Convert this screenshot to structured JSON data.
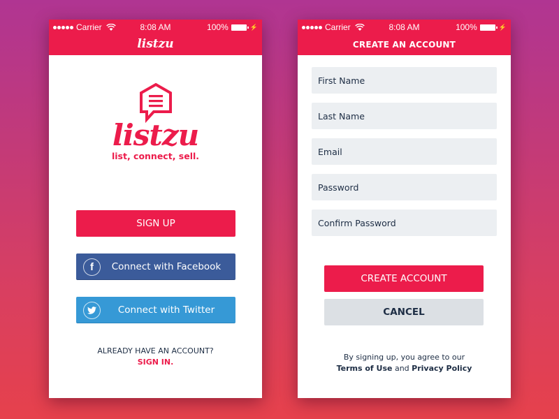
{
  "colors": {
    "brand": "#ec1c4b",
    "facebook": "#3b5b9a",
    "twitter": "#3699d6",
    "field_bg": "#eceff2",
    "cancel_bg": "#dce0e4",
    "text_dark": "#1d2d44"
  },
  "status_bar": {
    "carrier": "Carrier",
    "time": "8:08 AM",
    "battery": "100%",
    "signal_icon": "signal-dots-icon",
    "wifi_icon": "wifi-icon",
    "battery_icon": "battery-icon",
    "charging_icon": "bolt-icon"
  },
  "left_screen": {
    "nav_title": "listzu",
    "logo": {
      "icon": "house-chat-list-icon",
      "wordmark": "listzu",
      "tagline": "list, connect, sell."
    },
    "signup_button": "SIGN UP",
    "facebook_button": {
      "label": "Connect with Facebook",
      "icon": "f"
    },
    "twitter_button": {
      "label": "Connect with Twitter",
      "icon": "twitter-bird-icon"
    },
    "already_text": "ALREADY HAVE AN ACCOUNT?",
    "signin_link": "SIGN IN."
  },
  "right_screen": {
    "nav_title": "CREATE AN ACCOUNT",
    "fields": [
      {
        "placeholder": "First Name",
        "value": ""
      },
      {
        "placeholder": "Last Name",
        "value": ""
      },
      {
        "placeholder": "Email",
        "value": ""
      },
      {
        "placeholder": "Password",
        "value": ""
      },
      {
        "placeholder": "Confirm Password",
        "value": ""
      }
    ],
    "create_button": "CREATE ACCOUNT",
    "cancel_button": "CANCEL",
    "terms_line1": "By signing up, you agree to our",
    "terms_link": "Terms of Use",
    "terms_and": " and ",
    "privacy_link": "Privacy Policy"
  }
}
